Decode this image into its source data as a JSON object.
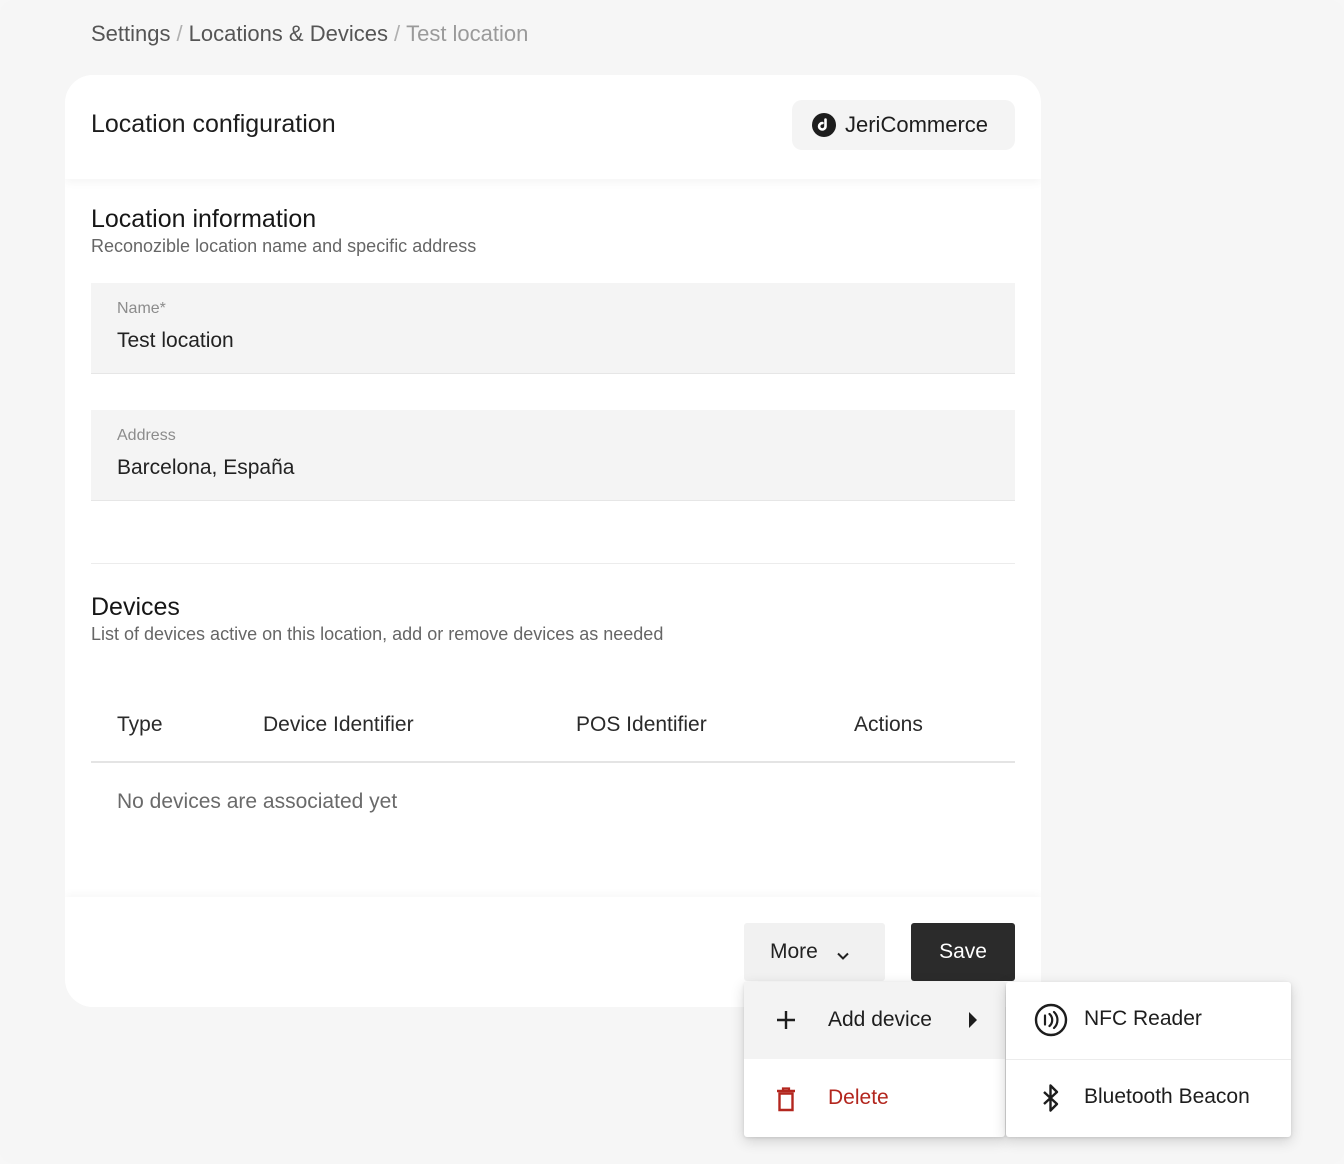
{
  "breadcrumb": {
    "settings": "Settings",
    "separator": "/",
    "locations": "Locations & Devices",
    "current": "Test location"
  },
  "header": {
    "title": "Location configuration",
    "organization": "JeriCommerce",
    "organization_icon": "brand-logo-icon"
  },
  "location_info": {
    "title": "Location information",
    "subtitle": "Reconozible location name and specific address",
    "name_label": "Name*",
    "name_value": "Test location",
    "address_label": "Address",
    "address_value": "Barcelona, España"
  },
  "devices": {
    "title": "Devices",
    "subtitle": "List of devices active on this location, add or remove devices as needed",
    "columns": [
      "Type",
      "Device Identifier",
      "POS Identifier",
      "Actions"
    ],
    "rows": [],
    "empty_message": "No devices are associated yet"
  },
  "footer": {
    "more_label": "More",
    "save_label": "Save"
  },
  "menu": {
    "items": [
      {
        "label": "Add device",
        "icon": "plus-icon",
        "color": "#1d1d1d",
        "has_submenu": true
      },
      {
        "label": "Delete",
        "icon": "trash-icon",
        "color": "#b3261e"
      }
    ]
  },
  "submenu": {
    "items": [
      {
        "label": "NFC Reader",
        "icon": "nfc-icon"
      },
      {
        "label": "Bluetooth Beacon",
        "icon": "bluetooth-icon"
      }
    ]
  },
  "colors": {
    "primary_button": "#2b2b2b",
    "danger": "#b3261e",
    "background": "#f6f6f6"
  }
}
